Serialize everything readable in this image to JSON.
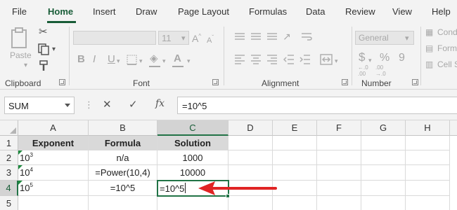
{
  "menu": {
    "tabs": [
      "File",
      "Home",
      "Insert",
      "Draw",
      "Page Layout",
      "Formulas",
      "Data",
      "Review",
      "View",
      "Help"
    ],
    "active_tab": "Home"
  },
  "ribbon": {
    "clipboard": {
      "paste_label": "Paste",
      "group_label": "Clipboard"
    },
    "font": {
      "font_size": "11",
      "group_label": "Font",
      "bold": "B",
      "italic": "I",
      "underline": "U"
    },
    "alignment": {
      "group_label": "Alignment"
    },
    "number": {
      "format": "General",
      "currency": "$",
      "percent": "%",
      "comma": "9",
      "group_label": "Number"
    },
    "styles": {
      "conditional_partial": "Cond",
      "format_partial": "Form",
      "cell_partial": "Cell S"
    }
  },
  "formula_bar": {
    "name_box": "SUM",
    "cancel_icon": "✕",
    "enter_icon": "✓",
    "fx_label": "fx",
    "content": "=10^5"
  },
  "grid": {
    "columns": [
      "A",
      "B",
      "C",
      "D",
      "E",
      "F",
      "G",
      "H"
    ],
    "rows": [
      "1",
      "2",
      "3",
      "4",
      "5"
    ],
    "header_row": [
      "Exponent",
      "Formula",
      "Solution"
    ],
    "data": [
      {
        "base": "10",
        "exp": "3",
        "formula": "n/a",
        "solution": "1000"
      },
      {
        "base": "10",
        "exp": "4",
        "formula": "=Power(10,4)",
        "solution": "10000"
      },
      {
        "base": "10",
        "exp": "5",
        "formula": "=10^5",
        "solution": "=10^5"
      }
    ],
    "active_cell": "C4"
  },
  "colors": {
    "accent": "#217346",
    "arrow": "#e02424",
    "header_fill": "#d9d9d9"
  }
}
